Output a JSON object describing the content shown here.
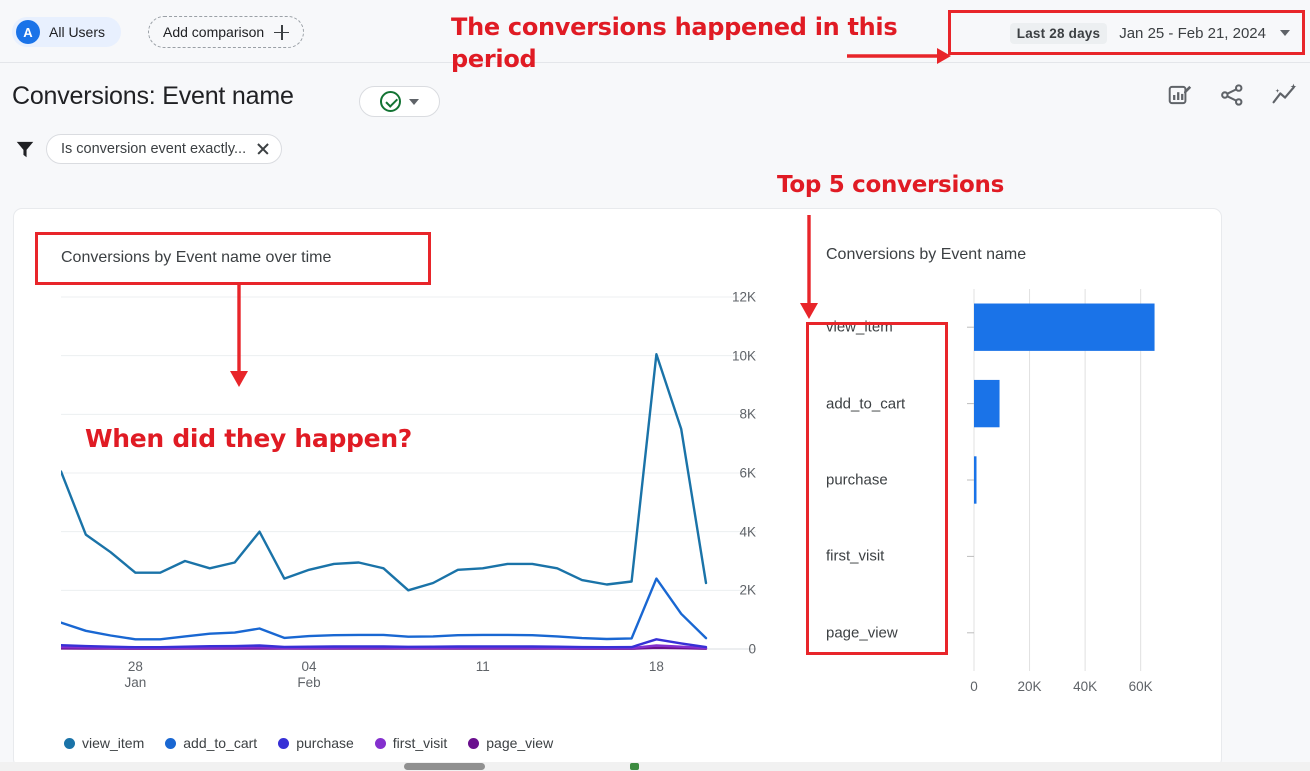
{
  "topbar": {
    "segment_label": "All Users",
    "segment_avatar": "A",
    "add_comparison_label": "Add comparison",
    "daterange_preset": "Last 28 days",
    "daterange_value": "Jan 25 - Feb 21, 2024"
  },
  "header": {
    "title": "Conversions: Event name",
    "icons": [
      "edit-chart-icon",
      "share-icon",
      "insights-icon"
    ]
  },
  "filter": {
    "chip_label": "Is conversion event exactly...",
    "funnel_icon": "filter-funnel-icon",
    "remove_icon": "close-icon"
  },
  "annotations": {
    "period": "The conversions happened in this period",
    "top5": "Top 5 conversions",
    "when": "When did they happen?",
    "accent_color": "#e01b24"
  },
  "chart_data": [
    {
      "type": "line",
      "title": "Conversions by Event name over time",
      "xlabel": "",
      "ylabel": "",
      "ylim": [
        0,
        12000
      ],
      "yticks": [
        "0",
        "2K",
        "4K",
        "6K",
        "8K",
        "10K",
        "12K"
      ],
      "ytick_values": [
        0,
        2000,
        4000,
        6000,
        8000,
        10000,
        12000
      ],
      "xticks": [
        {
          "label": "28",
          "sublabel": "Jan",
          "index": 3
        },
        {
          "label": "04",
          "sublabel": "Feb",
          "index": 10
        },
        {
          "label": "11",
          "sublabel": "",
          "index": 17
        },
        {
          "label": "18",
          "sublabel": "",
          "index": 24
        }
      ],
      "grid": true,
      "legend_position": "bottom",
      "series": [
        {
          "name": "view_item",
          "color": "#1a73a8",
          "values": [
            6050,
            3900,
            3300,
            2600,
            2600,
            3000,
            2750,
            2950,
            4000,
            2400,
            2700,
            2900,
            2950,
            2750,
            2000,
            2250,
            2700,
            2750,
            2900,
            2900,
            2750,
            2350,
            2200,
            2300,
            10050,
            7500,
            2250
          ]
        },
        {
          "name": "add_to_cart",
          "color": "#1967d2",
          "values": [
            900,
            620,
            460,
            330,
            330,
            430,
            520,
            560,
            700,
            380,
            440,
            470,
            480,
            480,
            420,
            430,
            470,
            480,
            480,
            470,
            430,
            370,
            340,
            360,
            2400,
            1200,
            370
          ]
        },
        {
          "name": "purchase",
          "color": "#3730d6",
          "values": [
            130,
            100,
            80,
            60,
            60,
            80,
            95,
            100,
            120,
            70,
            80,
            85,
            88,
            86,
            75,
            78,
            85,
            88,
            88,
            85,
            78,
            66,
            60,
            64,
            330,
            190,
            66
          ]
        },
        {
          "name": "first_visit",
          "color": "#8430ce",
          "values": [
            60,
            48,
            40,
            32,
            32,
            40,
            45,
            48,
            55,
            35,
            40,
            42,
            44,
            43,
            38,
            39,
            42,
            44,
            44,
            42,
            39,
            33,
            30,
            32,
            120,
            80,
            33
          ]
        },
        {
          "name": "page_view",
          "color": "#6a0f8e",
          "values": [
            20,
            16,
            13,
            11,
            11,
            13,
            15,
            16,
            18,
            12,
            13,
            14,
            15,
            14,
            13,
            13,
            14,
            15,
            15,
            14,
            13,
            11,
            10,
            11,
            40,
            27,
            11
          ]
        }
      ]
    },
    {
      "type": "bar",
      "orientation": "horizontal",
      "title": "Conversions by Event name",
      "categories": [
        "view_item",
        "add_to_cart",
        "purchase",
        "first_visit",
        "page_view"
      ],
      "values": [
        65000,
        9200,
        600,
        0,
        0
      ],
      "bar_color": "#1a73e8",
      "xlim": [
        0,
        72000
      ],
      "xticks": [
        "0",
        "20K",
        "40K",
        "60K"
      ],
      "xtick_values": [
        0,
        20000,
        40000,
        60000
      ],
      "grid": true
    }
  ]
}
